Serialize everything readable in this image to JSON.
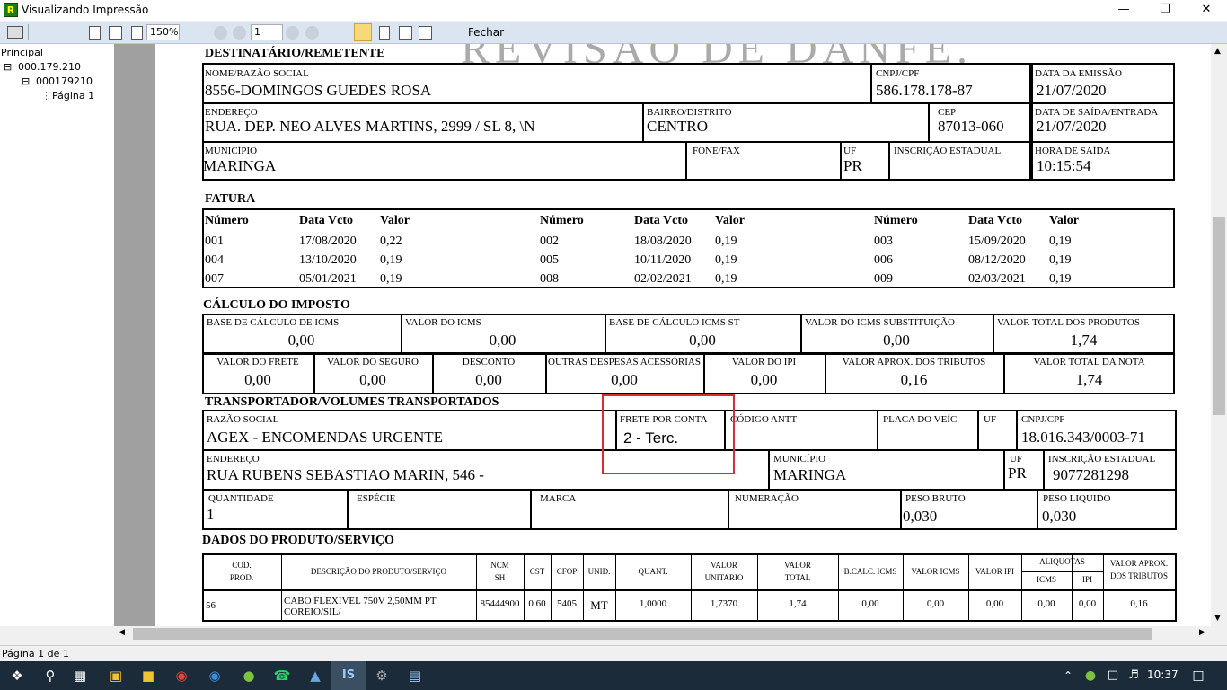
{
  "window": {
    "title": "Visualizando Impressão",
    "app_icon": "R"
  },
  "toolbar": {
    "zoom": "150%",
    "page_input": "1",
    "close_label": "Fechar"
  },
  "tree": {
    "root": "Principal",
    "node1": "000.179.210",
    "node2": "000179210",
    "leaf": "Página 1"
  },
  "watermark": "REVISÃO DE DANFE.",
  "dest": {
    "section": "DESTINATÁRIO/REMETENTE",
    "nome_lbl": "NOME/RAZÃO SOCIAL",
    "nome": "8556-DOMINGOS GUEDES ROSA",
    "cnpj_lbl": "CNPJ/CPF",
    "cnpj": "586.178.178-87",
    "emissao_lbl": "DATA DA EMISSÃO",
    "emissao": "21/07/2020",
    "end_lbl": "ENDEREÇO",
    "end": "RUA. DEP. NEO ALVES MARTINS, 2999 / SL 8, \\N",
    "bairro_lbl": "BAIRRO/DISTRITO",
    "bairro": "CENTRO",
    "cep_lbl": "CEP",
    "cep": "87013-060",
    "saida_lbl": "DATA DE SAÍDA/ENTRADA",
    "saida": "21/07/2020",
    "mun_lbl": "MUNICÍPIO",
    "mun": "MARINGA",
    "fone_lbl": "FONE/FAX",
    "fone": "",
    "uf_lbl": "UF",
    "uf": "PR",
    "ie_lbl": "INSCRIÇÃO ESTADUAL",
    "ie": "",
    "hora_lbl": "HORA DE SAÍDA",
    "hora": "10:15:54"
  },
  "fatura": {
    "section": "FATURA",
    "h_num": "Número",
    "h_data": "Data Vcto",
    "h_valor": "Valor",
    "cols": [
      [
        {
          "n": "001",
          "d": "17/08/2020",
          "v": "0,22"
        },
        {
          "n": "004",
          "d": "13/10/2020",
          "v": "0,19"
        },
        {
          "n": "007",
          "d": "05/01/2021",
          "v": "0,19"
        }
      ],
      [
        {
          "n": "002",
          "d": "18/08/2020",
          "v": "0,19"
        },
        {
          "n": "005",
          "d": "10/11/2020",
          "v": "0,19"
        },
        {
          "n": "008",
          "d": "02/02/2021",
          "v": "0,19"
        }
      ],
      [
        {
          "n": "003",
          "d": "15/09/2020",
          "v": "0,19"
        },
        {
          "n": "006",
          "d": "08/12/2020",
          "v": "0,19"
        },
        {
          "n": "009",
          "d": "02/03/2021",
          "v": "0,19"
        }
      ]
    ]
  },
  "imposto": {
    "section": "CÁLCULO DO IMPOSTO",
    "row1": [
      {
        "l": "BASE DE CÁLCULO DE ICMS",
        "v": "0,00"
      },
      {
        "l": "VALOR DO ICMS",
        "v": "0,00"
      },
      {
        "l": "BASE DE CÁLCULO ICMS ST",
        "v": "0,00"
      },
      {
        "l": "VALOR DO ICMS SUBSTITUIÇÃO",
        "v": "0,00"
      },
      {
        "l": "VALOR TOTAL DOS PRODUTOS",
        "v": "1,74"
      }
    ],
    "row2": [
      {
        "l": "VALOR DO FRETE",
        "v": "0,00"
      },
      {
        "l": "VALOR DO SEGURO",
        "v": "0,00"
      },
      {
        "l": "DESCONTO",
        "v": "0,00"
      },
      {
        "l": "OUTRAS DESPESAS ACESSÓRIAS",
        "v": "0,00"
      },
      {
        "l": "VALOR DO IPI",
        "v": "0,00"
      },
      {
        "l": "VALOR APROX. DOS TRIBUTOS",
        "v": "0,16"
      },
      {
        "l": "VALOR TOTAL DA NOTA",
        "v": "1,74"
      }
    ]
  },
  "transp": {
    "section": "TRANSPORTADOR/VOLUMES TRANSPORTADOS",
    "razao_lbl": "RAZÃO SOCIAL",
    "razao": "AGEX - ENCOMENDAS URGENTE",
    "frete_lbl": "FRETE POR CONTA",
    "frete": "2 - Terc.",
    "antt_lbl": "CÓDIGO ANTT",
    "placa_lbl": "PLACA DO VEÍC",
    "uf_lbl": "UF",
    "cnpj_lbl": "CNPJ/CPF",
    "cnpj": "18.016.343/0003-71",
    "end_lbl": "ENDEREÇO",
    "end": "RUA RUBENS SEBASTIAO MARIN, 546 -",
    "mun_lbl": "MUNICÍPIO",
    "mun": "MARINGA",
    "uf2_lbl": "UF",
    "uf2": "PR",
    "ie_lbl": "INSCRIÇÃO ESTADUAL",
    "ie": "9077281298",
    "qtd_lbl": "QUANTIDADE",
    "qtd": "1",
    "esp_lbl": "ESPÉCIE",
    "marca_lbl": "MARCA",
    "num_lbl": "NUMERAÇÃO",
    "pb_lbl": "PESO BRUTO",
    "pb": "0,030",
    "pl_lbl": "PESO LIQUIDO",
    "pl": "0,030"
  },
  "produtos": {
    "section": "DADOS DO PRODUTO/SERVIÇO",
    "h_cod": "COD.\nPROD.",
    "h_desc": "DESCRIÇÃO DO PRODUTO/SERVIÇO",
    "h_ncm": "NCM\nSH",
    "h_cst": "CST",
    "h_cfop": "CFOP",
    "h_unid": "UNID.",
    "h_quant": "QUANT.",
    "h_vunit": "VALOR\nUNITARIO",
    "h_vtot": "VALOR\nTOTAL",
    "h_bc": "B.CALC. ICMS",
    "h_vicms": "VALOR ICMS",
    "h_vipi": "VALOR IPI",
    "h_aliq": "ALIQUOTAS",
    "h_aicms": "ICMS",
    "h_aipi": "IPI",
    "h_vaprox": "VALOR APROX.\nDOS TRIBUTOS",
    "row": {
      "cod": "56",
      "desc": "CABO FLEXIVEL 750V 2,50MM PT COREIO/SIL/",
      "ncm": "85444900",
      "cst": "0  60",
      "cfop": "5405",
      "unid": "MT",
      "quant": "1,0000",
      "vunit": "1,7370",
      "vtot": "1,74",
      "bc": "0,00",
      "vicms": "0,00",
      "vipi": "0,00",
      "aicms": "0,00",
      "aipi": "0,00",
      "vaprox": "0,16"
    }
  },
  "status": {
    "text": "Página 1 de 1"
  },
  "taskbar": {
    "time": "10:37"
  }
}
